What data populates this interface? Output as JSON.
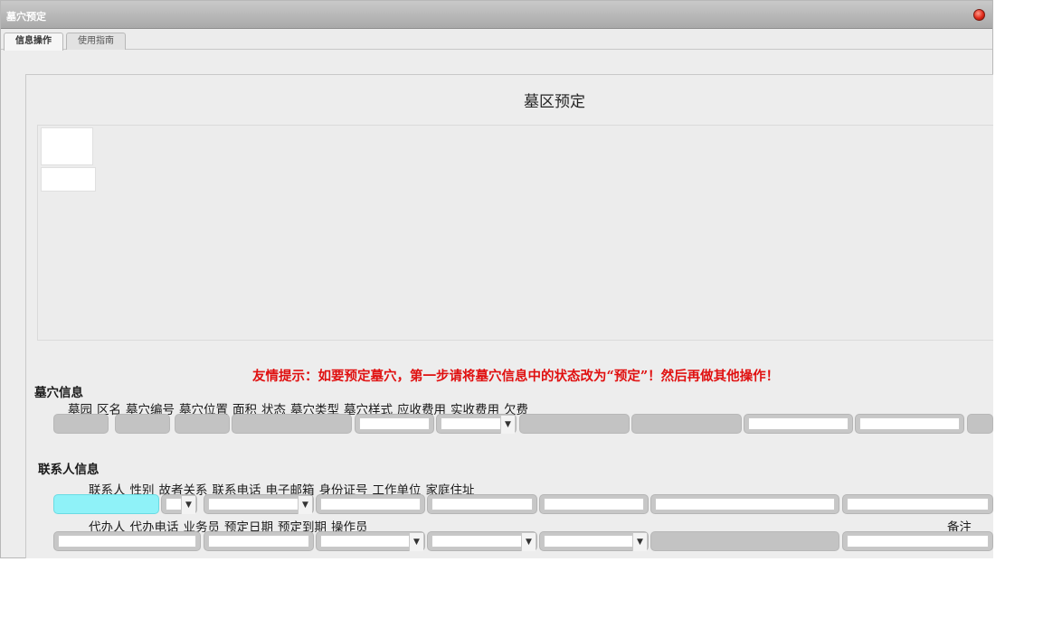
{
  "window": {
    "title": "墓穴预定"
  },
  "tabs": [
    {
      "label": "信息操作"
    },
    {
      "label": "使用指南"
    }
  ],
  "page_title": "墓区预定",
  "tip": "友情提示：如要预定墓穴，第一步请将墓穴信息中的状态改为“预定”！然后再做其他操作！",
  "grave_section": {
    "title": "墓穴信息",
    "labels": [
      "墓园",
      "区名",
      "墓穴编号",
      "墓穴位置",
      "面积",
      "状态",
      "墓穴类型",
      "墓穴样式",
      "应收费用",
      "实收费用",
      "欠费"
    ]
  },
  "contact_section": {
    "title": "联系人信息",
    "labels_row1": [
      "联系人",
      "性别",
      "故者关系",
      "联系电话",
      "电子邮箱",
      "身份证号",
      "工作单位",
      "家庭住址"
    ],
    "labels_row2": [
      "代办人",
      "代办电话",
      "业务员",
      "预定日期",
      "预定到期",
      "操作员"
    ],
    "remark_label": "备注"
  },
  "colors": {
    "tip": "#e01010",
    "highlight_field": "#8ff2f8",
    "title_bar": "#b5b5b5"
  },
  "icons": {
    "close": "close-icon",
    "dropdown": "chevron-down-icon"
  }
}
